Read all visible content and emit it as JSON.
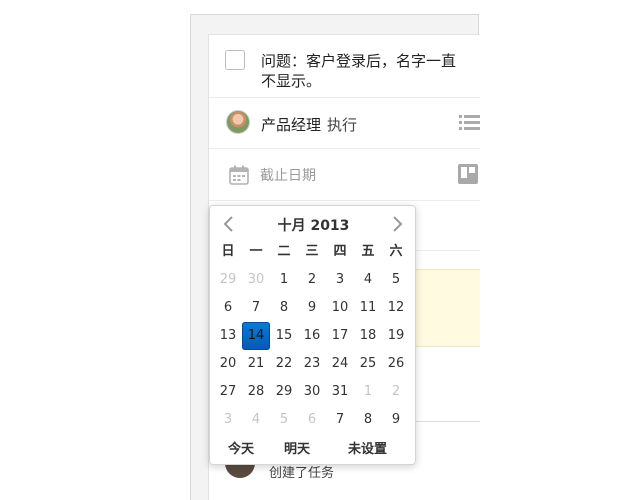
{
  "task": {
    "title": "问题：客户登录后，名字一直不显示。",
    "assignee_name": "产品经理",
    "assignee_action": "执行",
    "due_placeholder": "截止日期",
    "activity_text": "创建了任务"
  },
  "datepicker": {
    "month_title": "十月 2013",
    "weekdays": [
      "日",
      "一",
      "二",
      "三",
      "四",
      "五",
      "六"
    ],
    "weeks": [
      [
        "29",
        "30",
        "1",
        "2",
        "3",
        "4",
        "5"
      ],
      [
        "6",
        "7",
        "8",
        "9",
        "10",
        "11",
        "12"
      ],
      [
        "13",
        "14",
        "15",
        "16",
        "17",
        "18",
        "19"
      ],
      [
        "20",
        "21",
        "22",
        "23",
        "24",
        "25",
        "26"
      ],
      [
        "27",
        "28",
        "29",
        "30",
        "31",
        "1",
        "2"
      ],
      [
        "3",
        "4",
        "5",
        "6",
        "7",
        "8",
        "9"
      ]
    ],
    "selected_day": "14",
    "footer": {
      "today": "今天",
      "tomorrow": "明天",
      "unset": "未设置"
    }
  },
  "icons": {
    "prev": "chevron-left-icon",
    "next": "chevron-right-icon",
    "calendar": "calendar-icon",
    "list": "list-icon",
    "board": "board-icon"
  },
  "colors": {
    "selected_day_bg": "#0a6fd0",
    "note_bg": "#fffae0",
    "muted_text": "#c4c4c4"
  }
}
